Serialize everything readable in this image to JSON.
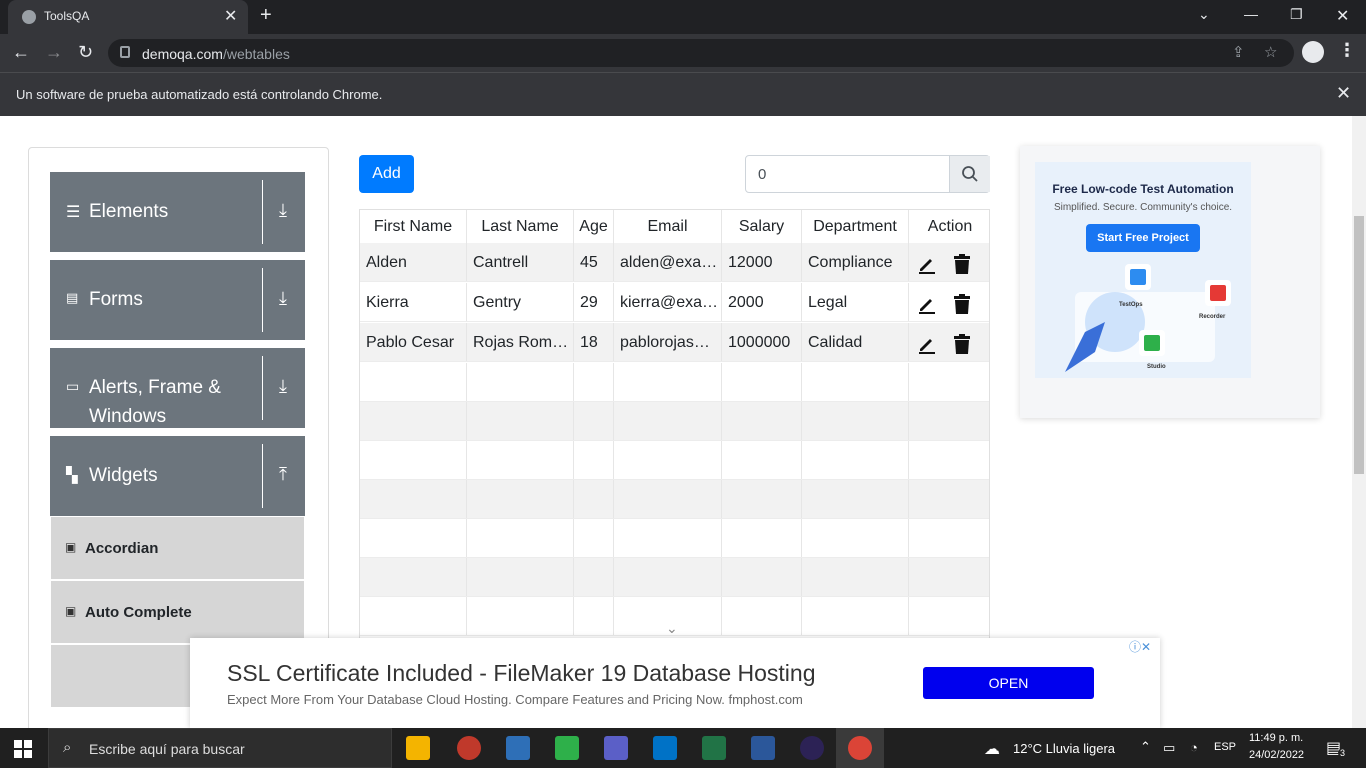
{
  "browser": {
    "tab_title": "ToolsQA",
    "url_host": "demoqa.com",
    "url_path": "/webtables",
    "infobar_text": "Un software de prueba automatizado está controlando Chrome."
  },
  "sidebar": {
    "groups": [
      {
        "label": "Elements",
        "icon": "hamburger-icon"
      },
      {
        "label": "Forms",
        "icon": "form-icon"
      },
      {
        "label": "Alerts, Frame & Windows",
        "icon": "window-icon"
      },
      {
        "label": "Widgets",
        "icon": "widgets-icon"
      }
    ],
    "sub_items": [
      {
        "label": "Accordian"
      },
      {
        "label": "Auto Complete"
      }
    ]
  },
  "toolbar": {
    "add_label": "Add",
    "search_value": "0"
  },
  "table": {
    "headers": [
      "First Name",
      "Last Name",
      "Age",
      "Email",
      "Salary",
      "Department",
      "Action"
    ],
    "rows": [
      [
        "Alden",
        "Cantrell",
        "45",
        "alden@example.com",
        "12000",
        "Compliance"
      ],
      [
        "Kierra",
        "Gentry",
        "29",
        "kierra@example.com",
        "2000",
        "Legal"
      ],
      [
        "Pablo Cesar",
        "Rojas Romero",
        "18",
        "pablorojas@example.com",
        "1000000",
        "Calidad"
      ]
    ]
  },
  "right_ad": {
    "title": "Free Low-code Test Automation",
    "subtitle": "Simplified. Secure. Community's choice.",
    "button": "Start Free Project",
    "labels": [
      "TestOps",
      "Recorder",
      "Studio"
    ]
  },
  "bottom_ad": {
    "title": "SSL Certificate Included - FileMaker 19 Database Hosting",
    "subtitle": "Expect More From Your Database Cloud Hosting. Compare Features and Pricing Now. fmphost.com",
    "button": "OPEN"
  },
  "taskbar": {
    "search_placeholder": "Escribe aquí para buscar",
    "weather": "12°C  Lluvia ligera",
    "language": "ESP",
    "time": "11:49 p. m.",
    "date": "24/02/2022",
    "notifications": "3"
  },
  "colors": {
    "primary": "#007bff",
    "sidebar_group": "#6c757d",
    "sub_item": "#d6d6d6"
  }
}
